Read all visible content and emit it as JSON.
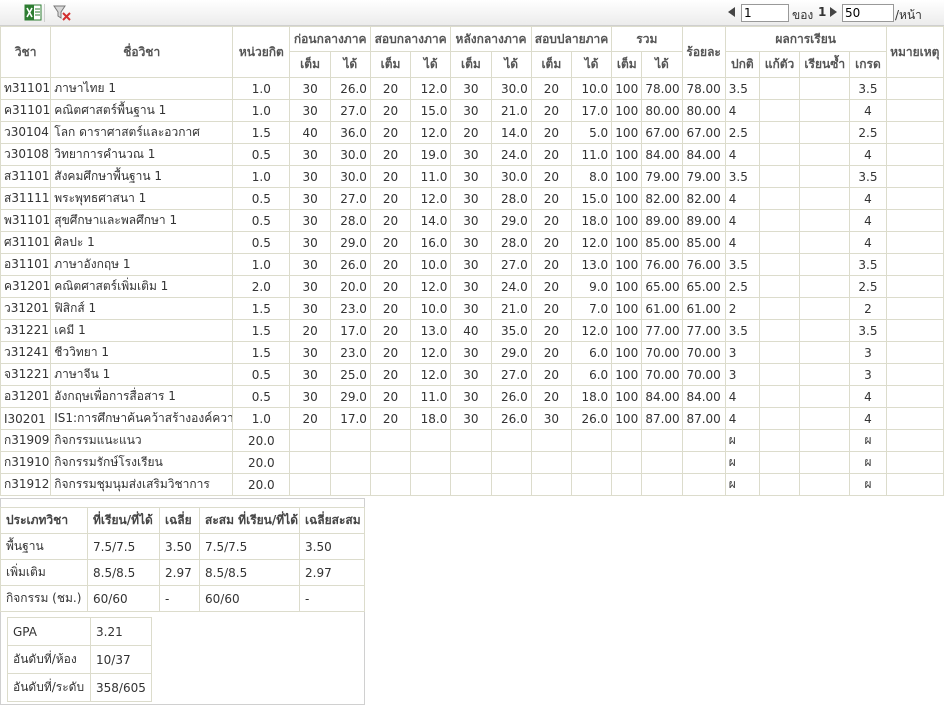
{
  "toolbar": {
    "excel_icon": "excel-icon",
    "filter_icon": "filter-clear-icon",
    "page_value": "1",
    "of_label": "ของ",
    "total_pages": "1",
    "page_size": "50",
    "per_page_label": "/หน้า"
  },
  "headers": {
    "code": "วิชา",
    "name": "ชื่อวิชา",
    "credit": "หน่วยกิต",
    "before_mid": "ก่อนกลางภาค",
    "mid_exam": "สอบกลางภาค",
    "after_mid": "หลังกลางภาค",
    "final_exam": "สอบปลายภาค",
    "total": "รวม",
    "percent": "ร้อยละ",
    "result": "ผลการเรียน",
    "note": "หมายเหตุ",
    "full": "เต็ม",
    "got": "ได้",
    "normal": "ปกติ",
    "fix": "แก้ตัว",
    "repeat": "เรียนซ้ำ",
    "grade": "เกรด"
  },
  "rows": [
    {
      "code": "ท31101",
      "name": "ภาษาไทย 1",
      "credit": "1.0",
      "f1": "30",
      "g1": "26.0",
      "f2": "20",
      "g2": "12.0",
      "f3": "30",
      "g3": "30.0",
      "f4": "20",
      "g4": "10.0",
      "ft": "100",
      "gt": "78.00",
      "pct": "78.00",
      "normal": "3.5",
      "fix": "",
      "repeat": "",
      "grade": "3.5",
      "note": ""
    },
    {
      "code": "ค31101",
      "name": "คณิตศาสตร์พื้นฐาน 1",
      "credit": "1.0",
      "f1": "30",
      "g1": "27.0",
      "f2": "20",
      "g2": "15.0",
      "f3": "30",
      "g3": "21.0",
      "f4": "20",
      "g4": "17.0",
      "ft": "100",
      "gt": "80.00",
      "pct": "80.00",
      "normal": "4",
      "fix": "",
      "repeat": "",
      "grade": "4",
      "note": ""
    },
    {
      "code": "ว30104",
      "name": "โลก ดาราศาสตร์และอวกาศ",
      "credit": "1.5",
      "f1": "40",
      "g1": "36.0",
      "f2": "20",
      "g2": "12.0",
      "f3": "20",
      "g3": "14.0",
      "f4": "20",
      "g4": "5.0",
      "ft": "100",
      "gt": "67.00",
      "pct": "67.00",
      "normal": "2.5",
      "fix": "",
      "repeat": "",
      "grade": "2.5",
      "note": ""
    },
    {
      "code": "ว30108",
      "name": "วิทยาการคำนวณ 1",
      "credit": "0.5",
      "f1": "30",
      "g1": "30.0",
      "f2": "20",
      "g2": "19.0",
      "f3": "30",
      "g3": "24.0",
      "f4": "20",
      "g4": "11.0",
      "ft": "100",
      "gt": "84.00",
      "pct": "84.00",
      "normal": "4",
      "fix": "",
      "repeat": "",
      "grade": "4",
      "note": ""
    },
    {
      "code": "ส31101",
      "name": "สังคมศึกษาพื้นฐาน 1",
      "credit": "1.0",
      "f1": "30",
      "g1": "30.0",
      "f2": "20",
      "g2": "11.0",
      "f3": "30",
      "g3": "30.0",
      "f4": "20",
      "g4": "8.0",
      "ft": "100",
      "gt": "79.00",
      "pct": "79.00",
      "normal": "3.5",
      "fix": "",
      "repeat": "",
      "grade": "3.5",
      "note": ""
    },
    {
      "code": "ส31111",
      "name": "พระพุทธศาสนา 1",
      "credit": "0.5",
      "f1": "30",
      "g1": "27.0",
      "f2": "20",
      "g2": "12.0",
      "f3": "30",
      "g3": "28.0",
      "f4": "20",
      "g4": "15.0",
      "ft": "100",
      "gt": "82.00",
      "pct": "82.00",
      "normal": "4",
      "fix": "",
      "repeat": "",
      "grade": "4",
      "note": ""
    },
    {
      "code": "พ31101",
      "name": "สุขศึกษาและพลศึกษา 1",
      "credit": "0.5",
      "f1": "30",
      "g1": "28.0",
      "f2": "20",
      "g2": "14.0",
      "f3": "30",
      "g3": "29.0",
      "f4": "20",
      "g4": "18.0",
      "ft": "100",
      "gt": "89.00",
      "pct": "89.00",
      "normal": "4",
      "fix": "",
      "repeat": "",
      "grade": "4",
      "note": ""
    },
    {
      "code": "ศ31101",
      "name": "ศิลปะ 1",
      "credit": "0.5",
      "f1": "30",
      "g1": "29.0",
      "f2": "20",
      "g2": "16.0",
      "f3": "30",
      "g3": "28.0",
      "f4": "20",
      "g4": "12.0",
      "ft": "100",
      "gt": "85.00",
      "pct": "85.00",
      "normal": "4",
      "fix": "",
      "repeat": "",
      "grade": "4",
      "note": ""
    },
    {
      "code": "อ31101",
      "name": "ภาษาอังกฤษ 1",
      "credit": "1.0",
      "f1": "30",
      "g1": "26.0",
      "f2": "20",
      "g2": "10.0",
      "f3": "30",
      "g3": "27.0",
      "f4": "20",
      "g4": "13.0",
      "ft": "100",
      "gt": "76.00",
      "pct": "76.00",
      "normal": "3.5",
      "fix": "",
      "repeat": "",
      "grade": "3.5",
      "note": ""
    },
    {
      "code": "ค31201",
      "name": "คณิตศาสตร์เพิ่มเติม 1",
      "credit": "2.0",
      "f1": "30",
      "g1": "20.0",
      "f2": "20",
      "g2": "12.0",
      "f3": "30",
      "g3": "24.0",
      "f4": "20",
      "g4": "9.0",
      "ft": "100",
      "gt": "65.00",
      "pct": "65.00",
      "normal": "2.5",
      "fix": "",
      "repeat": "",
      "grade": "2.5",
      "note": ""
    },
    {
      "code": "ว31201",
      "name": "ฟิสิกส์ 1",
      "credit": "1.5",
      "f1": "30",
      "g1": "23.0",
      "f2": "20",
      "g2": "10.0",
      "f3": "30",
      "g3": "21.0",
      "f4": "20",
      "g4": "7.0",
      "ft": "100",
      "gt": "61.00",
      "pct": "61.00",
      "normal": "2",
      "fix": "",
      "repeat": "",
      "grade": "2",
      "note": ""
    },
    {
      "code": "ว31221",
      "name": "เคมี 1",
      "credit": "1.5",
      "f1": "20",
      "g1": "17.0",
      "f2": "20",
      "g2": "13.0",
      "f3": "40",
      "g3": "35.0",
      "f4": "20",
      "g4": "12.0",
      "ft": "100",
      "gt": "77.00",
      "pct": "77.00",
      "normal": "3.5",
      "fix": "",
      "repeat": "",
      "grade": "3.5",
      "note": ""
    },
    {
      "code": "ว31241",
      "name": "ชีววิทยา 1",
      "credit": "1.5",
      "f1": "30",
      "g1": "23.0",
      "f2": "20",
      "g2": "12.0",
      "f3": "30",
      "g3": "29.0",
      "f4": "20",
      "g4": "6.0",
      "ft": "100",
      "gt": "70.00",
      "pct": "70.00",
      "normal": "3",
      "fix": "",
      "repeat": "",
      "grade": "3",
      "note": ""
    },
    {
      "code": "จ31221",
      "name": "ภาษาจีน 1",
      "credit": "0.5",
      "f1": "30",
      "g1": "25.0",
      "f2": "20",
      "g2": "12.0",
      "f3": "30",
      "g3": "27.0",
      "f4": "20",
      "g4": "6.0",
      "ft": "100",
      "gt": "70.00",
      "pct": "70.00",
      "normal": "3",
      "fix": "",
      "repeat": "",
      "grade": "3",
      "note": ""
    },
    {
      "code": "อ31201",
      "name": "อังกฤษเพื่อการสื่อสาร 1",
      "credit": "0.5",
      "f1": "30",
      "g1": "29.0",
      "f2": "20",
      "g2": "11.0",
      "f3": "30",
      "g3": "26.0",
      "f4": "20",
      "g4": "18.0",
      "ft": "100",
      "gt": "84.00",
      "pct": "84.00",
      "normal": "4",
      "fix": "",
      "repeat": "",
      "grade": "4",
      "note": ""
    },
    {
      "code": "I30201",
      "name": "IS1:การศึกษาค้นคว้าสร้างองค์ความรู้",
      "credit": "1.0",
      "f1": "20",
      "g1": "17.0",
      "f2": "20",
      "g2": "18.0",
      "f3": "30",
      "g3": "26.0",
      "f4": "30",
      "g4": "26.0",
      "ft": "100",
      "gt": "87.00",
      "pct": "87.00",
      "normal": "4",
      "fix": "",
      "repeat": "",
      "grade": "4",
      "note": ""
    },
    {
      "code": "ก31909",
      "name": "กิจกรรมแนะแนว",
      "credit": "20.0",
      "f1": "",
      "g1": "",
      "f2": "",
      "g2": "",
      "f3": "",
      "g3": "",
      "f4": "",
      "g4": "",
      "ft": "",
      "gt": "",
      "pct": "",
      "normal": "ผ",
      "fix": "",
      "repeat": "",
      "grade": "ผ",
      "note": ""
    },
    {
      "code": "ก31910",
      "name": "กิจกรรมรักษ์โรงเรียน",
      "credit": "20.0",
      "f1": "",
      "g1": "",
      "f2": "",
      "g2": "",
      "f3": "",
      "g3": "",
      "f4": "",
      "g4": "",
      "ft": "",
      "gt": "",
      "pct": "",
      "normal": "ผ",
      "fix": "",
      "repeat": "",
      "grade": "ผ",
      "note": ""
    },
    {
      "code": "ก31912",
      "name": "กิจกรรมชุมนุมส่งเสริมวิชาการ",
      "credit": "20.0",
      "f1": "",
      "g1": "",
      "f2": "",
      "g2": "",
      "f3": "",
      "g3": "",
      "f4": "",
      "g4": "",
      "ft": "",
      "gt": "",
      "pct": "",
      "normal": "ผ",
      "fix": "",
      "repeat": "",
      "grade": "ผ",
      "note": ""
    }
  ],
  "summary": {
    "headers": {
      "type": "ประเภทวิชา",
      "took": "ที่เรียน/ที่ได้",
      "avg": "เฉลี่ย",
      "cum": "สะสม ที่เรียน/ที่ได้",
      "cum_avg": "เฉลี่ยสะสม"
    },
    "rows": [
      {
        "type": "พื้นฐาน",
        "took": "7.5/7.5",
        "avg": "3.50",
        "cum": "7.5/7.5",
        "cum_avg": "3.50"
      },
      {
        "type": "เพิ่มเติม",
        "took": "8.5/8.5",
        "avg": "2.97",
        "cum": "8.5/8.5",
        "cum_avg": "2.97"
      },
      {
        "type": "กิจกรรม (ชม.)",
        "took": "60/60",
        "avg": "-",
        "cum": "60/60",
        "cum_avg": "-"
      }
    ],
    "gpa": [
      {
        "label": "GPA",
        "value": "3.21"
      },
      {
        "label": "อันดับที่/ห้อง",
        "value": "10/37"
      },
      {
        "label": "อันดับที่/ระดับ",
        "value": "358/605"
      }
    ]
  }
}
